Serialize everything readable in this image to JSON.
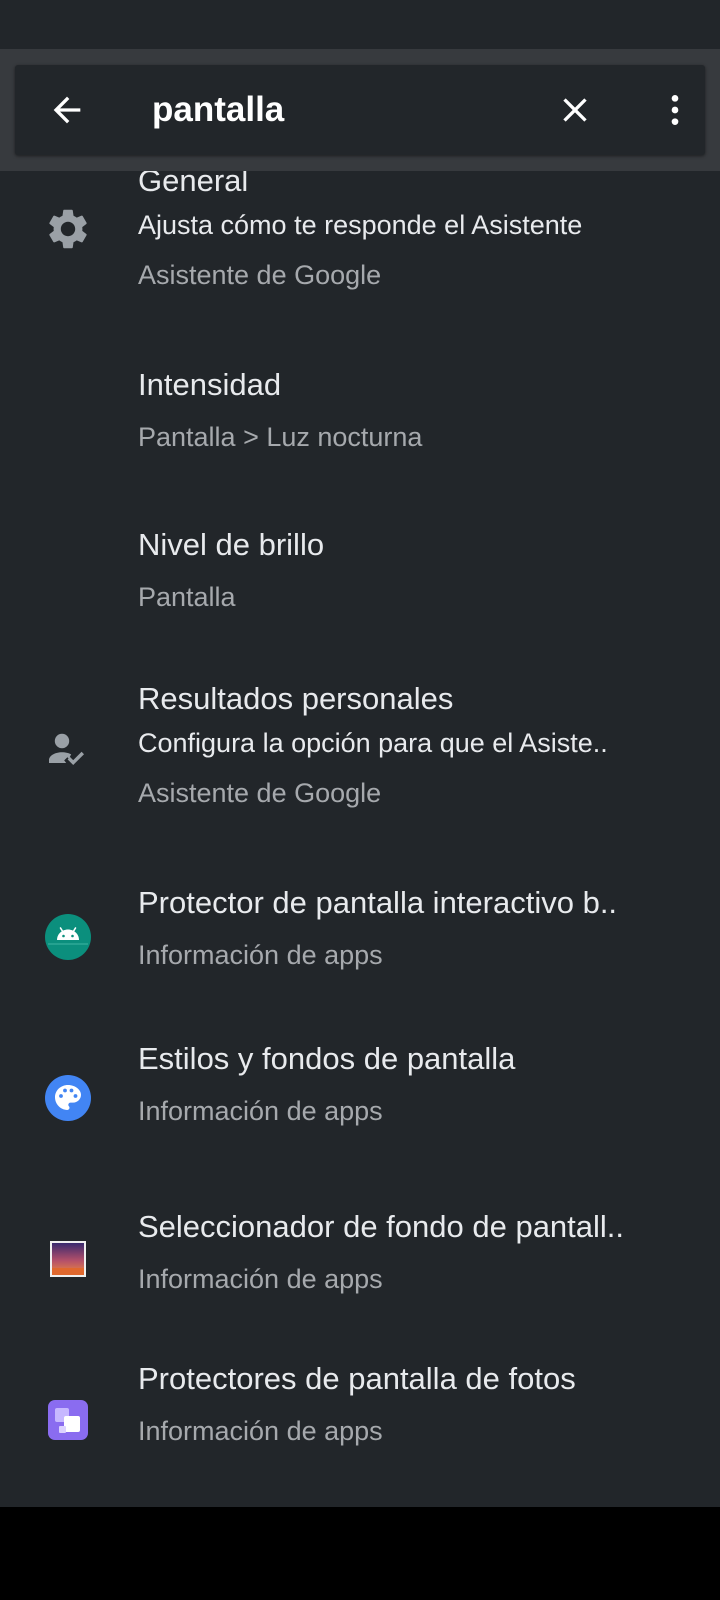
{
  "search": {
    "query": "pantalla",
    "back_icon": "arrow-back-icon",
    "clear_icon": "close-icon",
    "more_icon": "more-vert-icon"
  },
  "results": [
    {
      "title": "General",
      "summary": "Ajusta cómo te responde el Asistente",
      "breadcrumb": "Asistente de Google",
      "icon": "gear-icon"
    },
    {
      "title": "Intensidad",
      "breadcrumb": "Pantalla > Luz nocturna"
    },
    {
      "title": "Nivel de brillo",
      "breadcrumb": "Pantalla"
    },
    {
      "title": "Resultados personales",
      "summary": "Configura la opción para que el Asiste..",
      "breadcrumb": "Asistente de Google",
      "icon": "person-check-icon"
    },
    {
      "title": "Protector de pantalla interactivo b..",
      "breadcrumb": "Información de apps",
      "icon": "android-app-icon"
    },
    {
      "title": "Estilos y fondos de pantalla",
      "breadcrumb": "Información de apps",
      "icon": "palette-app-icon"
    },
    {
      "title": "Seleccionador de fondo de pantall..",
      "breadcrumb": "Información de apps",
      "icon": "wallpaper-picker-icon"
    },
    {
      "title": "Protectores de pantalla de fotos",
      "breadcrumb": "Información de apps",
      "icon": "photo-screensaver-icon"
    }
  ],
  "colors": {
    "background": "#22262a",
    "toolbar": "#373a3e",
    "primary_text": "#e8eaed",
    "secondary_text": "#a6a9ad",
    "android_icon": "#0b8f7d",
    "palette_icon": "#4285f4",
    "photos_icon": "#8a6cf0"
  }
}
